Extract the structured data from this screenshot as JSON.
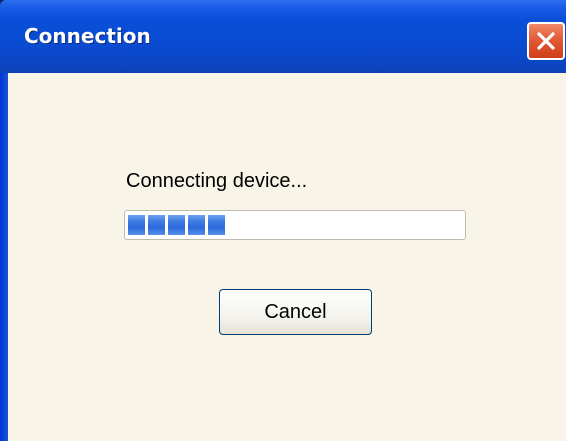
{
  "window": {
    "title": "Connection",
    "close_icon": "close-icon"
  },
  "dialog": {
    "status_text": "Connecting device...",
    "progress": {
      "filled_blocks": 5,
      "color": "#3a78e2"
    },
    "cancel_label": "Cancel"
  },
  "colors": {
    "titlebar": "#0a4fd8",
    "client_background": "#f8f5e8",
    "close_button": "#e25a36"
  }
}
